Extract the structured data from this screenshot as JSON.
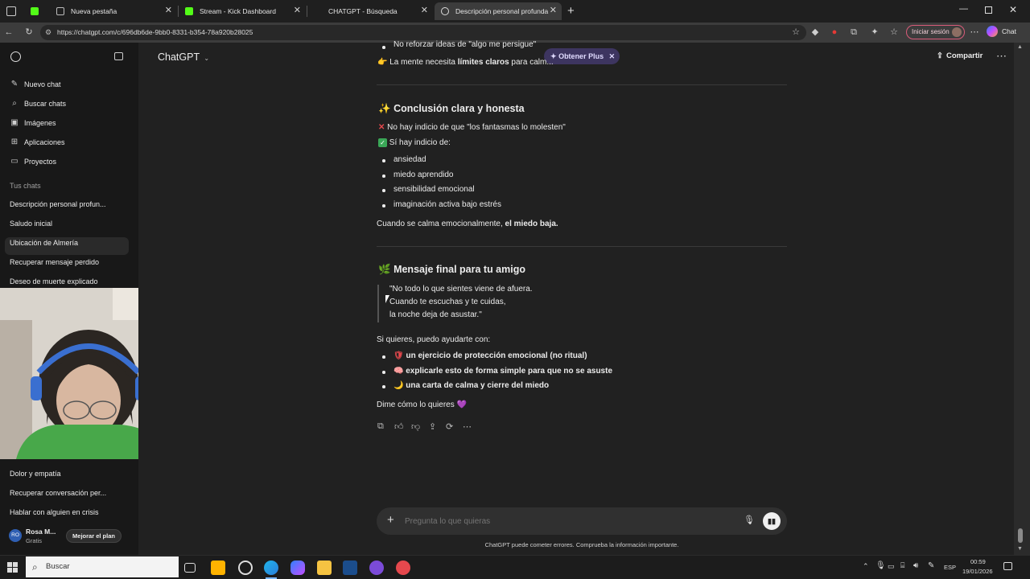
{
  "browser": {
    "tabs": [
      {
        "title": ""
      },
      {
        "title": "Nueva pestaña"
      },
      {
        "title": "Stream - Kick Dashboard"
      },
      {
        "title": "CHATGPT - Búsqueda"
      },
      {
        "title": "Descripción personal profunda"
      }
    ],
    "url": "https://chatgpt.com/c/696db6de-9bb0-8331-b354-78a920b28025",
    "signin_label": "Iniciar sesión",
    "chat_label": "Chat"
  },
  "sidebar": {
    "nav": [
      {
        "label": "Nuevo chat",
        "icon": "edit-icon"
      },
      {
        "label": "Buscar chats",
        "icon": "search-icon"
      },
      {
        "label": "Imágenes",
        "icon": "image-icon"
      },
      {
        "label": "Aplicaciones",
        "icon": "apps-icon"
      },
      {
        "label": "Proyectos",
        "icon": "folder-icon"
      }
    ],
    "section_title": "Tus chats",
    "chats_top": [
      "Descripción personal profun...",
      "Saludo inicial",
      "Ubicación de Almería",
      "Recuperar mensaje perdido",
      "Deseo de muerte explicado"
    ],
    "chats_bottom": [
      "Dolor y empatía",
      "Recuperar conversación per...",
      "Hablar con alguien en crisis"
    ],
    "user": {
      "initials": "RO",
      "name": "Rosa M...",
      "plan": "Gratis",
      "upgrade": "Mejorar el plan"
    }
  },
  "header": {
    "model": "ChatGPT",
    "get_plus": "Obtener Plus",
    "share": "Compartir"
  },
  "conversation": {
    "top_bullet": "No reforzar ideas de \"algo me persigue\"",
    "top_line_a": "La mente necesita ",
    "top_line_b": "límites claros",
    "top_line_c": " para calm...",
    "conclusion": {
      "title": "Conclusión clara y honesta",
      "no_line": "No hay indicio de que \"los fantasmas lo molesten\"",
      "yes_line": "Sí hay indicio de:",
      "items": [
        "ansiedad",
        "miedo aprendido",
        "sensibilidad emocional",
        "imaginación activa bajo estrés"
      ],
      "calm_a": "Cuando se calma emocionalmente, ",
      "calm_b": "el miedo baja."
    },
    "final": {
      "title": "Mensaje final para tu amigo",
      "quote": [
        "\"No todo lo que sientes viene de afuera.",
        "Cuando te escuchas y te cuidas,",
        "la noche deja de asustar.\""
      ],
      "offer": "Si quieres, puedo ayudarte con:",
      "options": [
        {
          "emoji": "🛡",
          "text": "un ejercicio de protección emocional (no ritual)"
        },
        {
          "emoji": "🧠",
          "text": "explicarle esto de forma simple para que no se asuste"
        },
        {
          "emoji": "🌙",
          "text": "una carta de calma y cierre del miedo"
        }
      ],
      "closing": "Dime cómo lo quieres 💜"
    }
  },
  "composer": {
    "placeholder": "Pregunta lo que quieras",
    "disclaimer": "ChatGPT puede cometer errores. Comprueba la información importante."
  },
  "taskbar": {
    "search_placeholder": "Buscar",
    "lang": "ESP",
    "time": "00:59",
    "date": "19/01/2026"
  },
  "colors": {
    "background": "#212121",
    "sidebar": "#181818",
    "accent_purple": "#8a6cff",
    "kick_green": "#53fc18"
  }
}
